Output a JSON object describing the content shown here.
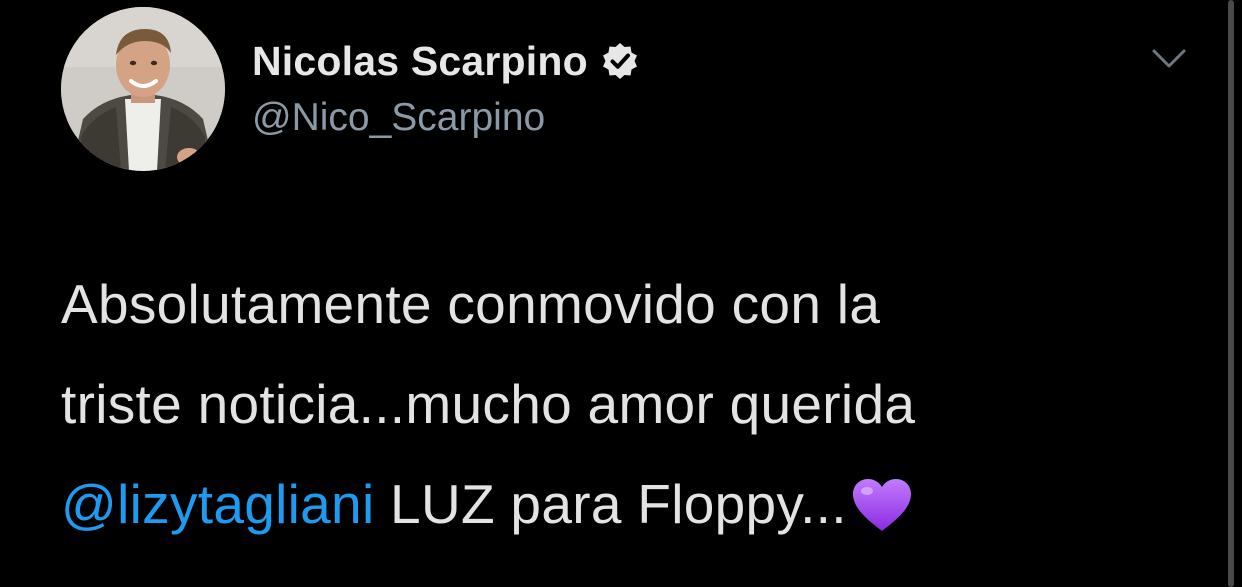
{
  "tweet": {
    "author": {
      "display_name": "Nicolas Scarpino",
      "handle": "@Nico_Scarpino",
      "verified": true,
      "avatar_icon": "profile-photo"
    },
    "menu_icon": "chevron-down-icon",
    "text": {
      "line1": "Absolutamente conmovido con la",
      "line2": "triste noticia...mucho amor querida",
      "mention": "@lizytagliani",
      "line3_rest": " LUZ para Floppy...",
      "emoji_icon": "purple-heart-icon"
    }
  },
  "colors": {
    "background": "#000000",
    "name_text": "#e7e7e7",
    "handle_text": "#8b98a5",
    "body_text": "#e3e3e3",
    "mention_link": "#1d9bf0",
    "heart": "#a64dff"
  }
}
